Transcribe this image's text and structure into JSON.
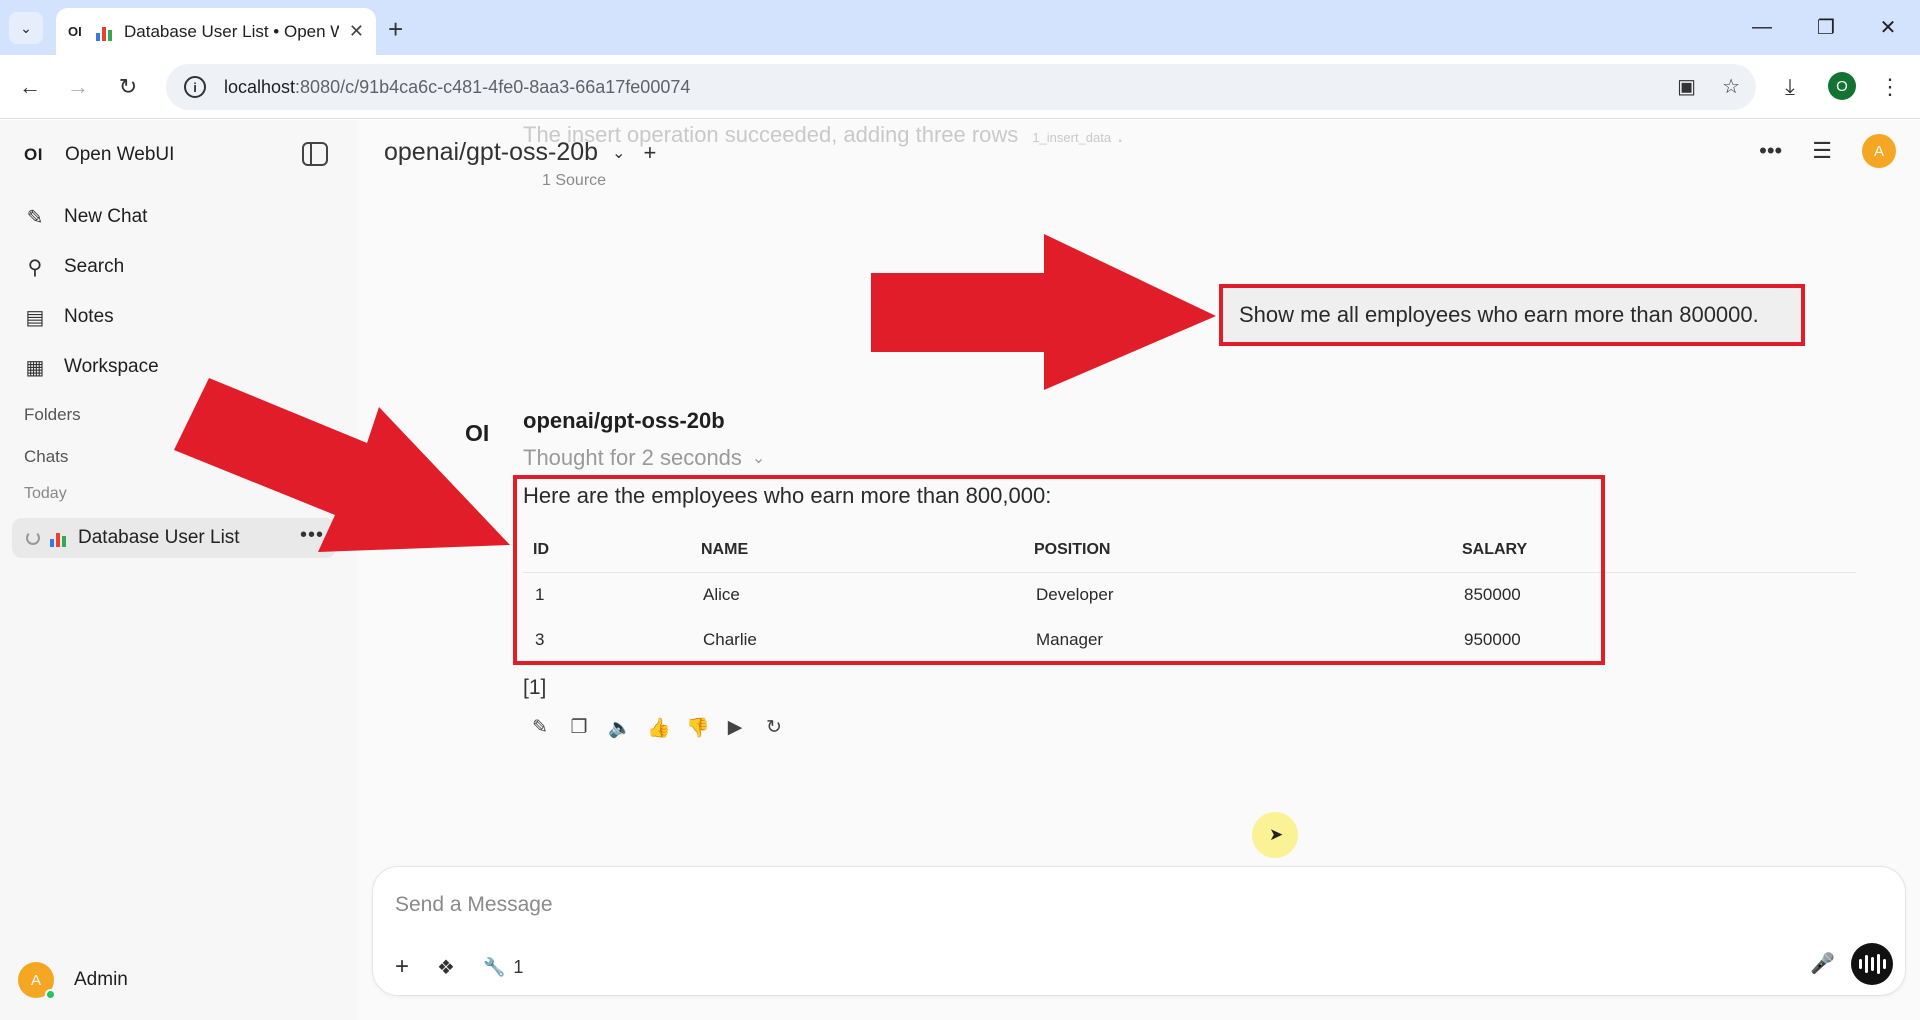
{
  "browser": {
    "tab_title": "Database User List • Open W",
    "tab_favicon": "OI",
    "url_host": "localhost",
    "url_path": ":8080/c/91b4ca6c-c481-4fe0-8aa3-66a17fe00074",
    "profile_initial": "O"
  },
  "sidebar": {
    "brand_logo": "OI",
    "brand_name": "Open WebUI",
    "items": [
      {
        "label": "New Chat",
        "icon": "edit-icon"
      },
      {
        "label": "Search",
        "icon": "search-icon"
      },
      {
        "label": "Notes",
        "icon": "notes-icon"
      },
      {
        "label": "Workspace",
        "icon": "workspace-icon"
      }
    ],
    "folders_label": "Folders",
    "chats_label": "Chats",
    "today_label": "Today",
    "chat_title": "Database User List",
    "user_initial": "A",
    "user_name": "Admin"
  },
  "header": {
    "model": "openai/gpt-oss-20b",
    "faded_text": "The insert operation succeeded, adding three rows",
    "faded_tag": "1_insert_data",
    "faded_period": ".",
    "source_count": "1 Source",
    "avatar_initial": "A"
  },
  "conversation": {
    "user_message": "Show me all employees who earn more than 800000.",
    "assistant_logo": "OI",
    "assistant_name": "openai/gpt-oss-20b",
    "thought_label": "Thought for 2 seconds",
    "answer_intro": "Here are the employees who earn more than 800,000:",
    "table": {
      "headers": [
        "ID",
        "NAME",
        "POSITION",
        "SALARY"
      ],
      "rows": [
        [
          "1",
          "Alice",
          "Developer",
          "850000"
        ],
        [
          "3",
          "Charlie",
          "Manager",
          "950000"
        ]
      ]
    },
    "citation": "[1]"
  },
  "composer": {
    "placeholder": "Send a Message",
    "tools_count": "1"
  },
  "colors": {
    "annotation_red": "#e11d2a",
    "avatar_orange": "#f5a623",
    "online_green": "#22c55e"
  }
}
